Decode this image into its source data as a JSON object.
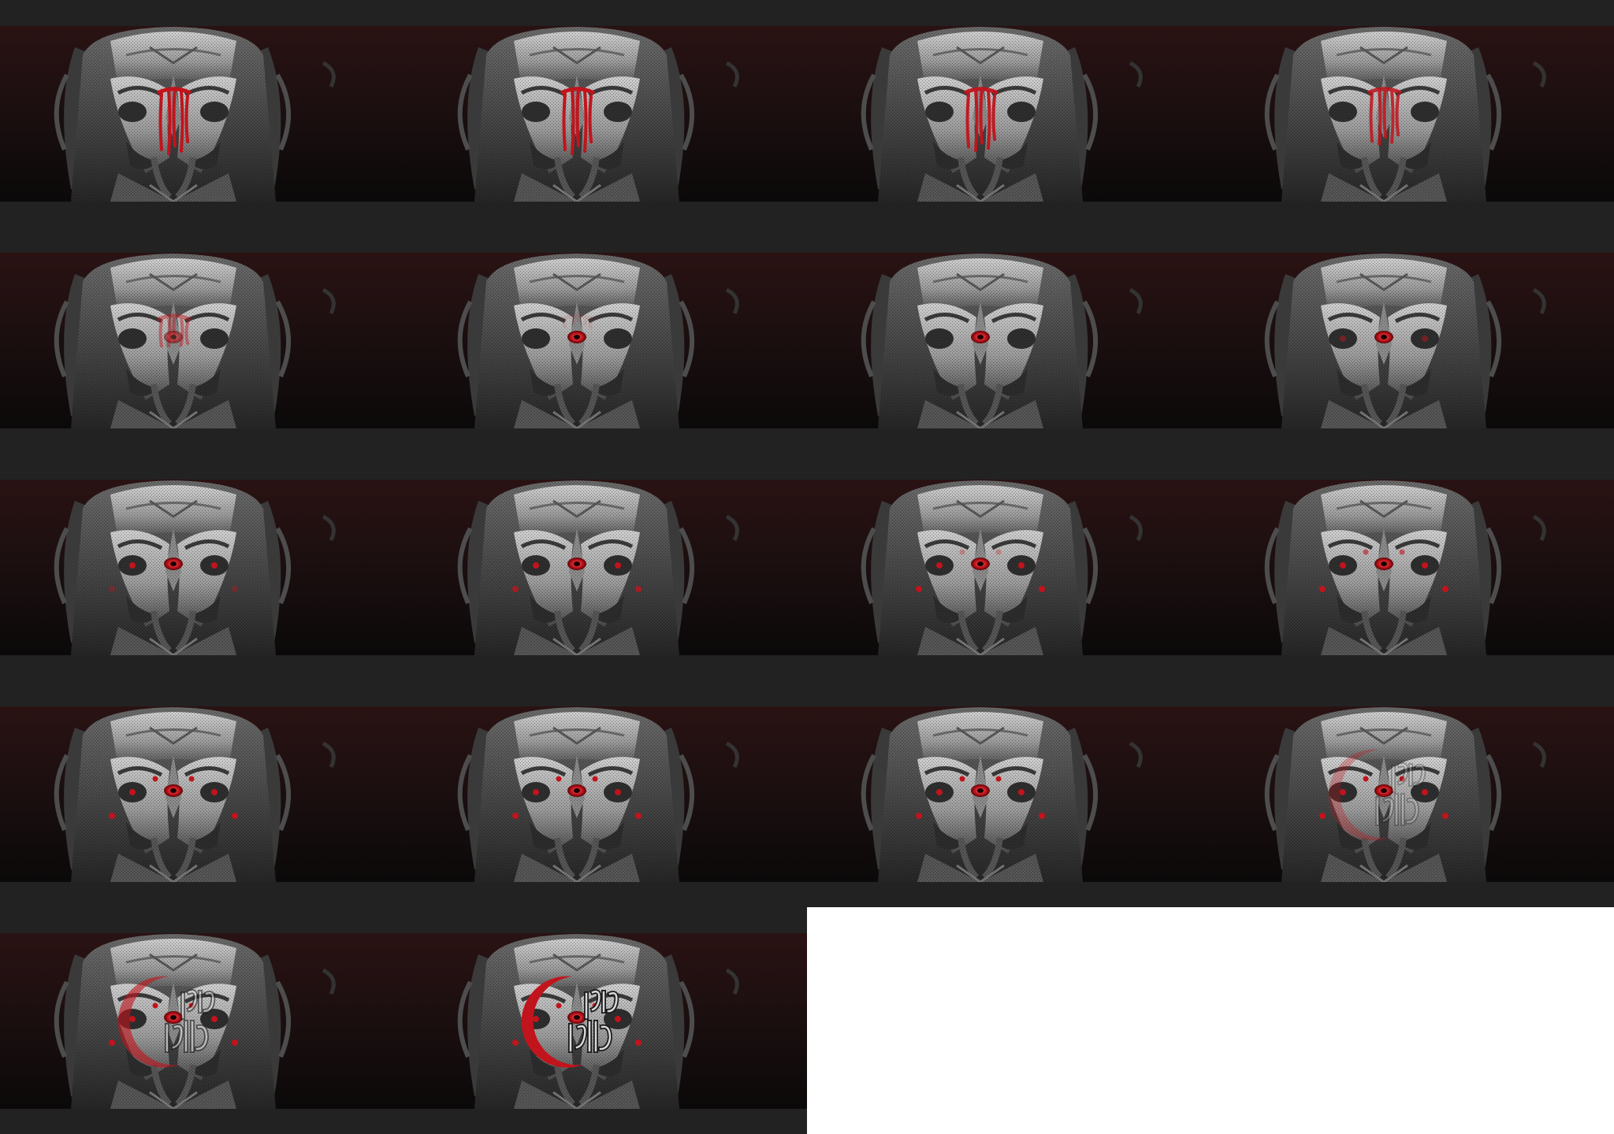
{
  "sheet": {
    "title": "",
    "columns": 4,
    "frame_count": 18,
    "background": "#ffffff",
    "frame_border_color": "#222222",
    "backdrop_top": "#2a1213",
    "backdrop_bottom": "#0b0909",
    "stone_light": "#bdbdbd",
    "stone_dark": "#3e3e3e",
    "accent": "#c1141c"
  },
  "frames": [
    {
      "blood": 1.0,
      "center_eye": 0.0,
      "side_eyes": 0.0,
      "cheek_eyes": 0.0,
      "brow_eyes": 0.0,
      "logo": 0.0
    },
    {
      "blood": 1.0,
      "center_eye": 0.0,
      "side_eyes": 0.0,
      "cheek_eyes": 0.0,
      "brow_eyes": 0.0,
      "logo": 0.0
    },
    {
      "blood": 0.95,
      "center_eye": 0.0,
      "side_eyes": 0.0,
      "cheek_eyes": 0.0,
      "brow_eyes": 0.0,
      "logo": 0.0
    },
    {
      "blood": 0.85,
      "center_eye": 0.0,
      "side_eyes": 0.0,
      "cheek_eyes": 0.0,
      "brow_eyes": 0.0,
      "logo": 0.0
    },
    {
      "blood": 0.45,
      "center_eye": 0.6,
      "side_eyes": 0.0,
      "cheek_eyes": 0.0,
      "brow_eyes": 0.0,
      "logo": 0.0
    },
    {
      "blood": 0.1,
      "center_eye": 1.0,
      "side_eyes": 0.0,
      "cheek_eyes": 0.0,
      "brow_eyes": 0.0,
      "logo": 0.0
    },
    {
      "blood": 0.0,
      "center_eye": 1.0,
      "side_eyes": 0.0,
      "cheek_eyes": 0.0,
      "brow_eyes": 0.0,
      "logo": 0.0
    },
    {
      "blood": 0.0,
      "center_eye": 1.0,
      "side_eyes": 0.5,
      "cheek_eyes": 0.0,
      "brow_eyes": 0.0,
      "logo": 0.0
    },
    {
      "blood": 0.0,
      "center_eye": 1.0,
      "side_eyes": 1.0,
      "cheek_eyes": 0.4,
      "brow_eyes": 0.0,
      "logo": 0.0
    },
    {
      "blood": 0.0,
      "center_eye": 1.0,
      "side_eyes": 1.0,
      "cheek_eyes": 0.8,
      "brow_eyes": 0.0,
      "logo": 0.0
    },
    {
      "blood": 0.0,
      "center_eye": 1.0,
      "side_eyes": 1.0,
      "cheek_eyes": 1.0,
      "brow_eyes": 0.3,
      "logo": 0.0
    },
    {
      "blood": 0.0,
      "center_eye": 1.0,
      "side_eyes": 1.0,
      "cheek_eyes": 1.0,
      "brow_eyes": 0.6,
      "logo": 0.0
    },
    {
      "blood": 0.0,
      "center_eye": 1.0,
      "side_eyes": 1.0,
      "cheek_eyes": 1.0,
      "brow_eyes": 1.0,
      "logo": 0.0
    },
    {
      "blood": 0.0,
      "center_eye": 1.0,
      "side_eyes": 1.0,
      "cheek_eyes": 1.0,
      "brow_eyes": 1.0,
      "logo": 0.0
    },
    {
      "blood": 0.0,
      "center_eye": 1.0,
      "side_eyes": 1.0,
      "cheek_eyes": 1.0,
      "brow_eyes": 1.0,
      "logo": 0.0
    },
    {
      "blood": 0.0,
      "center_eye": 1.0,
      "side_eyes": 1.0,
      "cheek_eyes": 1.0,
      "brow_eyes": 1.0,
      "logo": 0.3
    },
    {
      "blood": 0.0,
      "center_eye": 1.0,
      "side_eyes": 1.0,
      "cheek_eyes": 1.0,
      "brow_eyes": 1.0,
      "logo": 0.6
    },
    {
      "blood": 0.0,
      "center_eye": 1.0,
      "side_eyes": 1.0,
      "cheek_eyes": 1.0,
      "brow_eyes": 1.0,
      "logo": 1.0
    }
  ]
}
